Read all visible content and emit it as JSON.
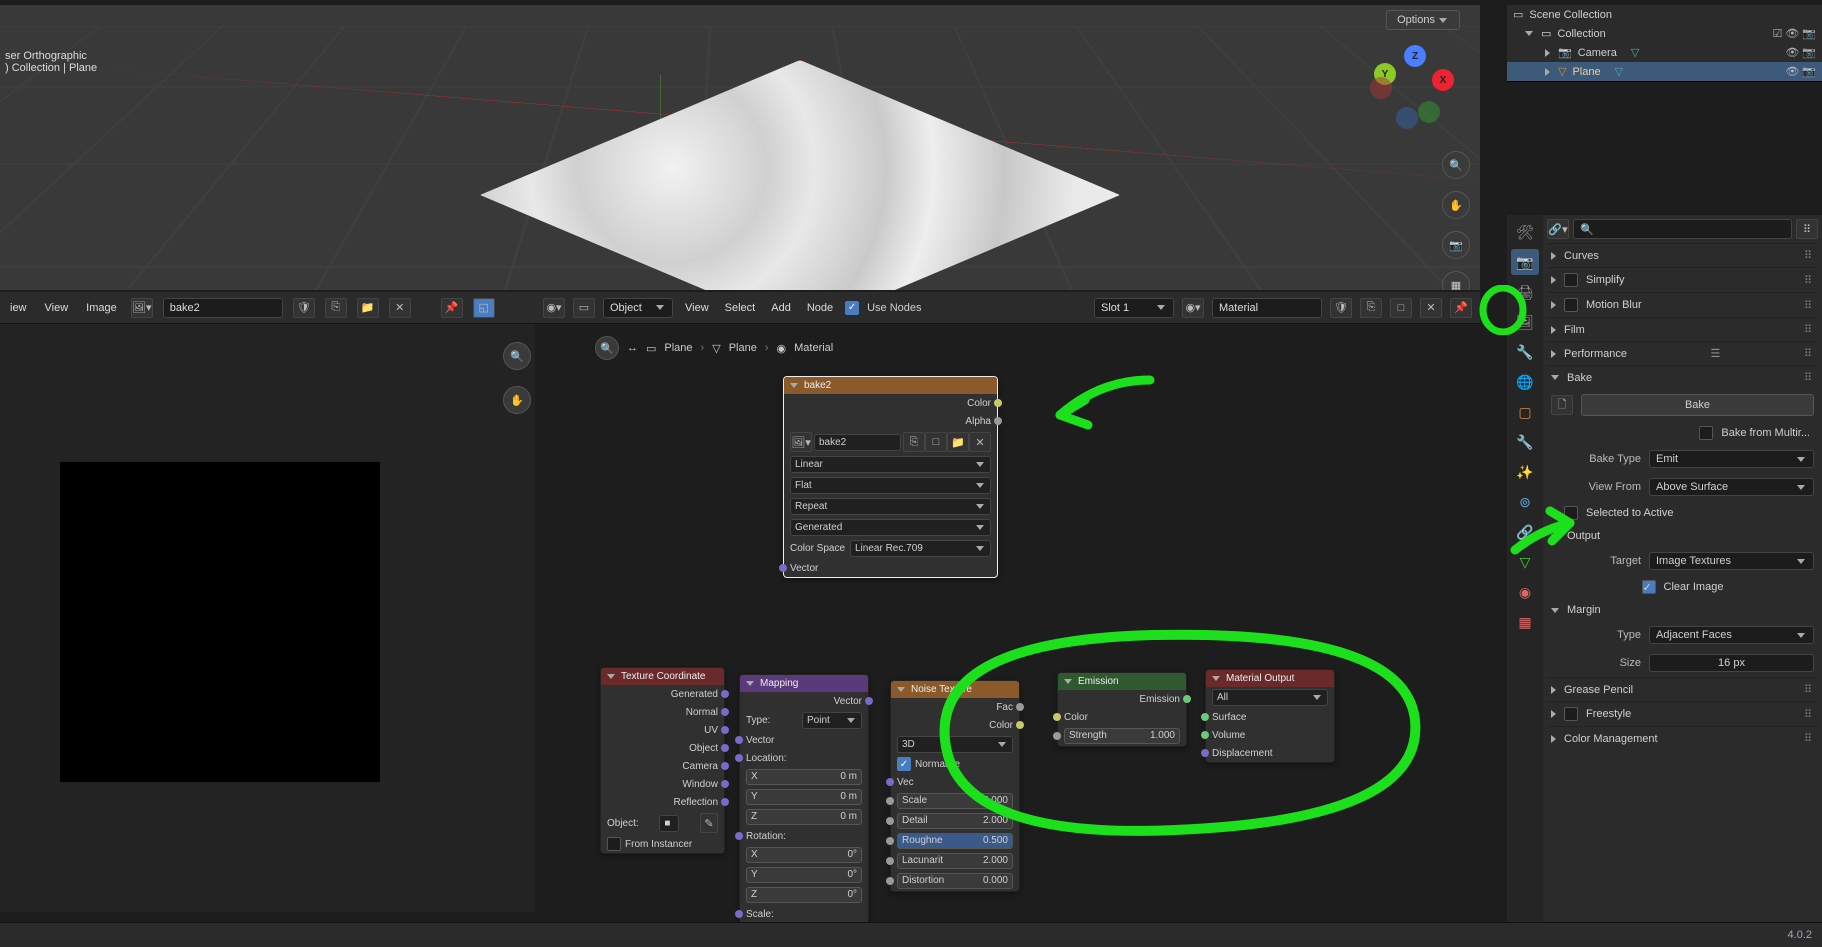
{
  "version_label": "4.0.2",
  "viewport": {
    "info_line1": "ser Orthographic",
    "info_line2": ") Collection | Plane",
    "options_label": "Options"
  },
  "outliner": {
    "scene": "Scene Collection",
    "collection": "Collection",
    "items": [
      {
        "name": "Camera"
      },
      {
        "name": "Plane"
      }
    ]
  },
  "image_editor": {
    "menus": [
      "iew",
      "View",
      "Image"
    ],
    "image_name": "bake2"
  },
  "node_editor": {
    "mode_label": "Object",
    "menus": [
      "View",
      "Select",
      "Add",
      "Node"
    ],
    "use_nodes_label": "Use Nodes",
    "slot_label": "Slot 1",
    "material_name": "Material",
    "breadcrumb": [
      "Plane",
      "Plane",
      "Material"
    ],
    "nodes": {
      "img_tex": {
        "title": "bake2",
        "outputs": [
          "Color",
          "Alpha"
        ],
        "image_name": "bake2",
        "interp": "Linear",
        "proj": "Flat",
        "ext": "Repeat",
        "src": "Generated",
        "cspace_label": "Color Space",
        "cspace_value": "Linear Rec.709",
        "vector": "Vector"
      },
      "texcoord": {
        "title": "Texture Coordinate",
        "outputs": [
          "Generated",
          "Normal",
          "UV",
          "Object",
          "Camera",
          "Window",
          "Reflection"
        ],
        "object_label": "Object:",
        "from_instancer": "From Instancer"
      },
      "mapping": {
        "title": "Mapping",
        "vector_out": "Vector",
        "type_label": "Type:",
        "type_value": "Point",
        "vector_in": "Vector",
        "loc_label": "Location:",
        "xyz": [
          "X",
          "Y",
          "Z"
        ],
        "loc_vals": [
          "0 m",
          "0 m",
          "0 m"
        ],
        "rot_label": "Rotation:",
        "rot_vals": [
          "0°",
          "0°",
          "0°"
        ],
        "scale_label": "Scale:"
      },
      "noise": {
        "title": "Noise Texture",
        "fac": "Fac",
        "color": "Color",
        "dim": "3D",
        "normalize": "Normalize",
        "vector": "Vec",
        "params": [
          {
            "name": "Scale",
            "val": "5.000"
          },
          {
            "name": "Detail",
            "val": "2.000"
          },
          {
            "name": "Roughne",
            "val": "0.500",
            "hl": true
          },
          {
            "name": "Lacunarit",
            "val": "2.000"
          },
          {
            "name": "Distortion",
            "val": "0.000"
          }
        ]
      },
      "emission": {
        "title": "Emission",
        "out": "Emission",
        "color": "Color",
        "strength_label": "Strength",
        "strength_val": "1.000"
      },
      "output": {
        "title": "Material Output",
        "target": "All",
        "surface": "Surface",
        "volume": "Volume",
        "disp": "Displacement"
      }
    }
  },
  "properties": {
    "search_placeholder": "",
    "sections_collapsed": [
      "Curves",
      "Simplify",
      "Motion Blur",
      "Film",
      "Performance"
    ],
    "bake": {
      "title": "Bake",
      "button": "Bake",
      "from_multires": "Bake from Multir...",
      "type_label": "Bake Type",
      "type_value": "Emit",
      "viewfrom_label": "View From",
      "viewfrom_value": "Above Surface",
      "selected_to_active": "Selected to Active",
      "output_title": "Output",
      "target_label": "Target",
      "target_value": "Image Textures",
      "clear_image": "Clear Image",
      "margin_title": "Margin",
      "margin_type_label": "Type",
      "margin_type_value": "Adjacent Faces",
      "size_label": "Size",
      "size_value": "16 px"
    },
    "sections_after": [
      "Grease Pencil",
      "Freestyle",
      "Color Management"
    ]
  },
  "gizmo_axes": {
    "x": "X",
    "y": "Y",
    "z": "Z"
  }
}
